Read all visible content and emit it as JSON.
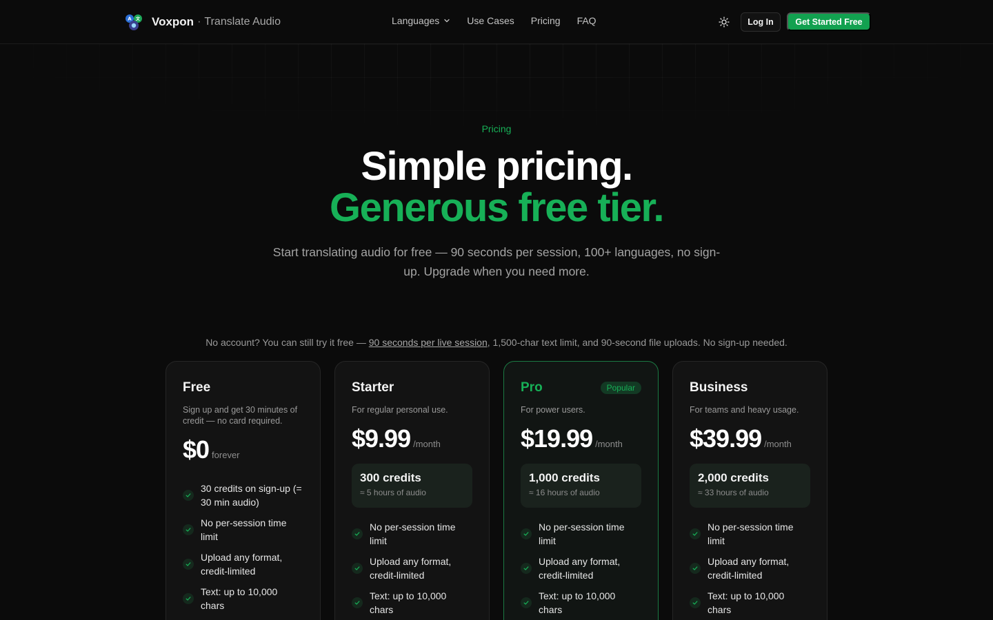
{
  "header": {
    "brand_name": "Voxpon",
    "brand_separator": "·",
    "brand_sub": "Translate Audio",
    "nav": [
      {
        "label": "Languages",
        "has_dropdown": true
      },
      {
        "label": "Use Cases"
      },
      {
        "label": "Pricing"
      },
      {
        "label": "FAQ"
      }
    ],
    "login_label": "Log In",
    "cta_label": "Get Started Free"
  },
  "hero": {
    "eyebrow": "Pricing",
    "title_line1": "Simple pricing.",
    "title_line2": "Generous free tier.",
    "lead": "Start translating audio for free — 90 seconds per session, 100+ languages, no sign-up. Upgrade when you need more."
  },
  "notice": {
    "before": "No account? You can still try it free — ",
    "link": "90 seconds per live session",
    "after": ", 1,500-char text limit, and 90-second file uploads. No sign-up needed."
  },
  "plans": [
    {
      "name": "Free",
      "desc": "Sign up and get 30 minutes of credit — no card required.",
      "price": "$0",
      "period": "forever",
      "features": [
        "30 credits on sign-up (= 30 min audio)",
        "No per-session time limit",
        "Upload any format, credit-limited",
        "Text: up to 10,000 chars"
      ]
    },
    {
      "name": "Starter",
      "desc": "For regular personal use.",
      "price": "$9.99",
      "period": "/month",
      "credits": "300 credits",
      "credits_sub": "≈ 5 hours of audio",
      "features": [
        "No per-session time limit",
        "Upload any format, credit-limited",
        "Text: up to 10,000 chars"
      ]
    },
    {
      "name": "Pro",
      "badge": "Popular",
      "desc": "For power users.",
      "price": "$19.99",
      "period": "/month",
      "credits": "1,000 credits",
      "credits_sub": "≈ 16 hours of audio",
      "features": [
        "No per-session time limit",
        "Upload any format, credit-limited",
        "Text: up to 10,000 chars"
      ]
    },
    {
      "name": "Business",
      "desc": "For teams and heavy usage.",
      "price": "$39.99",
      "period": "/month",
      "credits": "2,000 credits",
      "credits_sub": "≈ 33 hours of audio",
      "features": [
        "No per-session time limit",
        "Upload any format, credit-limited",
        "Text: up to 10,000 chars"
      ]
    }
  ],
  "colors": {
    "accent": "#17b057",
    "background": "#0b0b0b",
    "card": "#131313"
  },
  "icons": [
    "voxpon-logo-icon",
    "chevron-down-icon",
    "sun-icon",
    "check-icon"
  ]
}
